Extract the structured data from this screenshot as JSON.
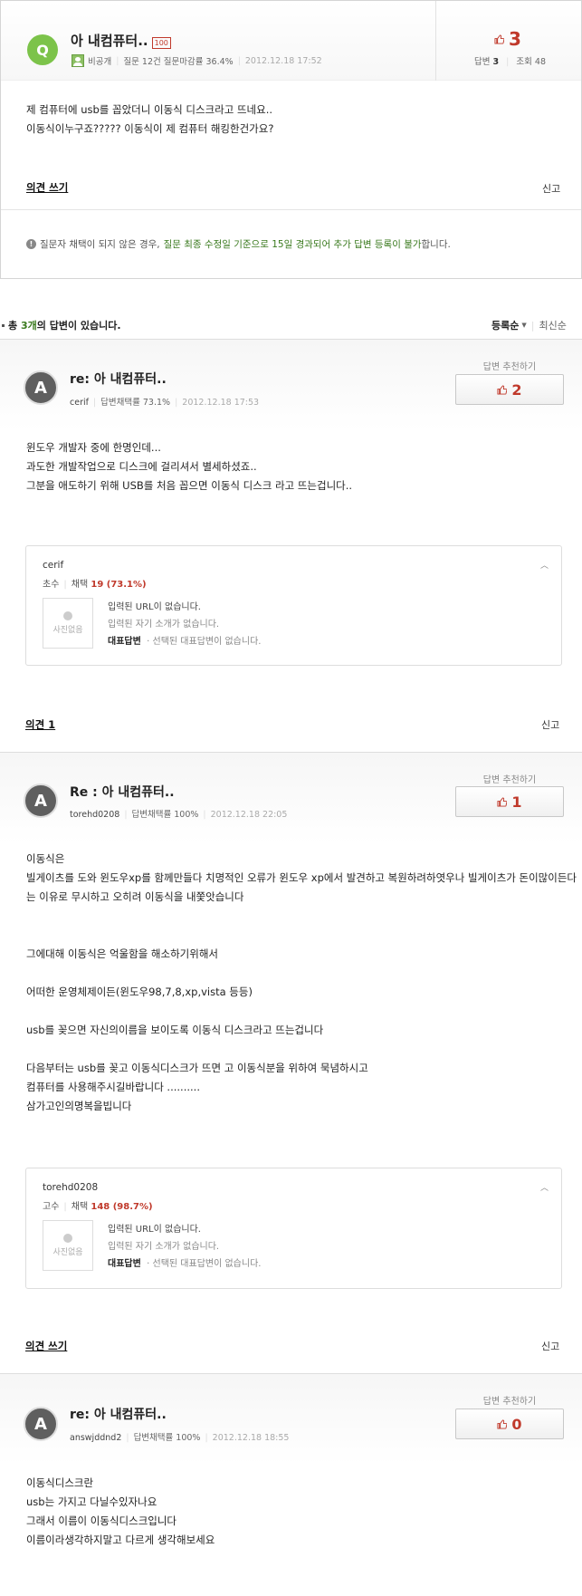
{
  "question": {
    "avatar_letter": "Q",
    "title": "아 내컴퓨터..",
    "badge": "100",
    "author": "비공개",
    "stats": "질문 12건 질문마감률 36.4%",
    "date": "2012.12.18 17:52",
    "rec_count": "3",
    "answers_label": "답변",
    "answers_count": "3",
    "views_label": "조회",
    "views_count": "48",
    "body": "제 컴퓨터에 usb를 꼽았더니 이동식 디스크라고 뜨네요..\n이동식이누구죠????? 이동식이 제 컴퓨터 해킹한건가요?",
    "comment_link": "의견 쓰기",
    "report": "신고",
    "notice_pre": "질문자 채택이 되지 않은 경우,",
    "notice_green": "질문 최종 수정일 기준으로 15일 경과되어 추가 답변 등록이 불가",
    "notice_post": "합니다."
  },
  "answers_header": {
    "prefix": "총",
    "count": "3개",
    "suffix": "의 답변이 있습니다.",
    "sort_reg": "등록순",
    "sort_new": "최신순"
  },
  "answers": [
    {
      "title": "re: 아 내컴퓨터..",
      "author": "cerif",
      "stats": "답변채택률 73.1%",
      "date": "2012.12.18 17:53",
      "rec_label": "답변 추천하기",
      "rec_count": "2",
      "body": "윈도우 개발자 중에 한명인데...\n과도한 개발작업으로 디스크에 걸리셔서 별세하셨죠..\n그분을 애도하기 위해 USB를 처음 꼽으면 이동식 디스크 라고 뜨는겁니다..",
      "profile": {
        "name": "cerif",
        "rank": "초수",
        "adopt": "채택",
        "adopt_val": "19 (73.1%)",
        "no_photo": "사진없음",
        "url": "입력된 URL이 없습니다.",
        "intro": "입력된 자기 소개가 없습니다.",
        "rep_label": "대표답변",
        "rep_text": "· 선택된 대표답변이 없습니다."
      },
      "comment_link": "의견 1",
      "report": "신고"
    },
    {
      "title": "Re : 아 내컴퓨터..",
      "author": "torehd0208",
      "stats": "답변채택률 100%",
      "date": "2012.12.18 22:05",
      "rec_label": "답변 추천하기",
      "rec_count": "1",
      "body": "이동식은\n빌게이츠를 도와 윈도우xp를 함께만들다 치명적인 오류가 윈도우 xp에서 발견하고 복원하려하엿우나 빌게이츠가 돈이많이든다는 이유로 무시하고 오히려 이동식을 내쫓앗습니다\n\n\n그에대해 이동식은 억울함을 해소하기위해서\n\n어떠한 운영체제이든(윈도우98,7,8,xp,vista 등등)\n\nusb를 꽂으면 자신의이름을 보이도록 이동식 디스크라고 뜨는겁니다\n\n다음부터는 usb를 꽂고 이동식디스크가 뜨면 고 이동식분을 위하여 묵념하시고\n컴퓨터를 사용해주시길바랍니다 ..........\n삼가고인의명복을빕니다",
      "profile": {
        "name": "torehd0208",
        "rank": "고수",
        "adopt": "채택",
        "adopt_val": "148 (98.7%)",
        "no_photo": "사진없음",
        "url": "입력된 URL이 없습니다.",
        "intro": "입력된 자기 소개가 없습니다.",
        "rep_label": "대표답변",
        "rep_text": "· 선택된 대표답변이 없습니다."
      },
      "comment_link": "의견 쓰기",
      "report": "신고"
    },
    {
      "title": "re: 아 내컴퓨터..",
      "author": "answjddnd2",
      "stats": "답변채택률 100%",
      "date": "2012.12.18 18:55",
      "rec_label": "답변 추천하기",
      "rec_count": "0",
      "body": "이동식디스크란\nusb는 가지고 다닐수있자나요\n그래서 이름이 이동식디스크입니다\n이름이라생각하지말고 다르게 생각해보세요"
    }
  ],
  "colors": {
    "accent_red": "#c0392b",
    "green": "#7cc34a",
    "notice_green": "#3a7a1e"
  }
}
